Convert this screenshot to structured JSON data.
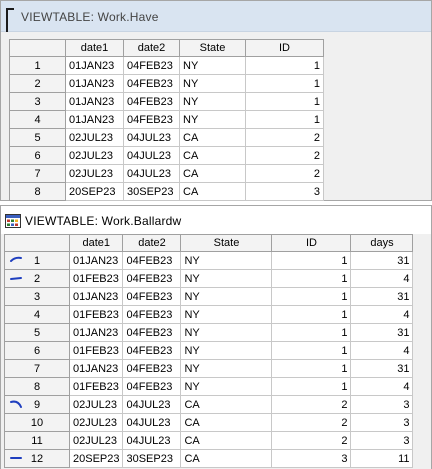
{
  "window1": {
    "title": "VIEWTABLE: Work.Have",
    "columns": [
      "date1",
      "date2",
      "State",
      "ID"
    ],
    "rows": [
      {
        "n": "1",
        "date1": "01JAN23",
        "date2": "04FEB23",
        "state": "NY",
        "id": "1"
      },
      {
        "n": "2",
        "date1": "01JAN23",
        "date2": "04FEB23",
        "state": "NY",
        "id": "1"
      },
      {
        "n": "3",
        "date1": "01JAN23",
        "date2": "04FEB23",
        "state": "NY",
        "id": "1"
      },
      {
        "n": "4",
        "date1": "01JAN23",
        "date2": "04FEB23",
        "state": "NY",
        "id": "1"
      },
      {
        "n": "5",
        "date1": "02JUL23",
        "date2": "04JUL23",
        "state": "CA",
        "id": "2"
      },
      {
        "n": "6",
        "date1": "02JUL23",
        "date2": "04JUL23",
        "state": "CA",
        "id": "2"
      },
      {
        "n": "7",
        "date1": "02JUL23",
        "date2": "04JUL23",
        "state": "CA",
        "id": "2"
      },
      {
        "n": "8",
        "date1": "20SEP23",
        "date2": "30SEP23",
        "state": "CA",
        "id": "3"
      }
    ]
  },
  "window2": {
    "title": "VIEWTABLE: Work.Ballardw",
    "app_icon": "sas-table-icon",
    "columns": [
      "date1",
      "date2",
      "State",
      "ID",
      "days"
    ],
    "rows": [
      {
        "n": "1",
        "date1": "01JAN23",
        "date2": "04FEB23",
        "state": "NY",
        "id": "1",
        "days": "31"
      },
      {
        "n": "2",
        "date1": "01FEB23",
        "date2": "04FEB23",
        "state": "NY",
        "id": "1",
        "days": "4"
      },
      {
        "n": "3",
        "date1": "01JAN23",
        "date2": "04FEB23",
        "state": "NY",
        "id": "1",
        "days": "31"
      },
      {
        "n": "4",
        "date1": "01FEB23",
        "date2": "04FEB23",
        "state": "NY",
        "id": "1",
        "days": "4"
      },
      {
        "n": "5",
        "date1": "01JAN23",
        "date2": "04FEB23",
        "state": "NY",
        "id": "1",
        "days": "31"
      },
      {
        "n": "6",
        "date1": "01FEB23",
        "date2": "04FEB23",
        "state": "NY",
        "id": "1",
        "days": "4"
      },
      {
        "n": "7",
        "date1": "01JAN23",
        "date2": "04FEB23",
        "state": "NY",
        "id": "1",
        "days": "31"
      },
      {
        "n": "8",
        "date1": "01FEB23",
        "date2": "04FEB23",
        "state": "NY",
        "id": "1",
        "days": "4"
      },
      {
        "n": "9",
        "date1": "02JUL23",
        "date2": "04JUL23",
        "state": "CA",
        "id": "2",
        "days": "3"
      },
      {
        "n": "10",
        "date1": "02JUL23",
        "date2": "04JUL23",
        "state": "CA",
        "id": "2",
        "days": "3"
      },
      {
        "n": "11",
        "date1": "02JUL23",
        "date2": "04JUL23",
        "state": "CA",
        "id": "2",
        "days": "3"
      },
      {
        "n": "12",
        "date1": "20SEP23",
        "date2": "30SEP23",
        "state": "CA",
        "id": "3",
        "days": "11"
      }
    ],
    "annotation_color": "#1f3fbf"
  }
}
